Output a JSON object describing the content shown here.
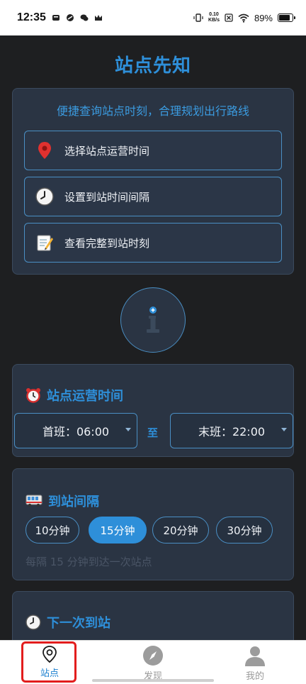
{
  "status_bar": {
    "time": "12:35",
    "net_speed_value": "0.10",
    "net_speed_unit": "KB/s",
    "battery": "89%",
    "battery_level": 0.89
  },
  "app": {
    "title": "站点先知"
  },
  "intro": {
    "subtitle": "便捷查询站点时刻，合理规划出行路线",
    "features": [
      {
        "label": "选择站点运营时间",
        "icon": "pin-icon"
      },
      {
        "label": "设置到站时间间隔",
        "icon": "clock-icon"
      },
      {
        "label": "查看完整到站时刻",
        "icon": "memo-icon"
      }
    ]
  },
  "hours": {
    "title": "站点运营时间",
    "first": "首班：06:00",
    "to": "至",
    "last": "末班：22:00"
  },
  "interval": {
    "title": "到站间隔",
    "options": [
      "10分钟",
      "15分钟",
      "20分钟",
      "30分钟"
    ],
    "selected_index": 1,
    "note": "每隔 15 分钟到达一次站点"
  },
  "next": {
    "title": "下一次到站"
  },
  "nav": {
    "station": "站点",
    "discover": "发现",
    "mine": "我的"
  },
  "colors": {
    "accent": "#2e8fd9",
    "card": "#2a3443",
    "highlight": "#e21d1d"
  }
}
